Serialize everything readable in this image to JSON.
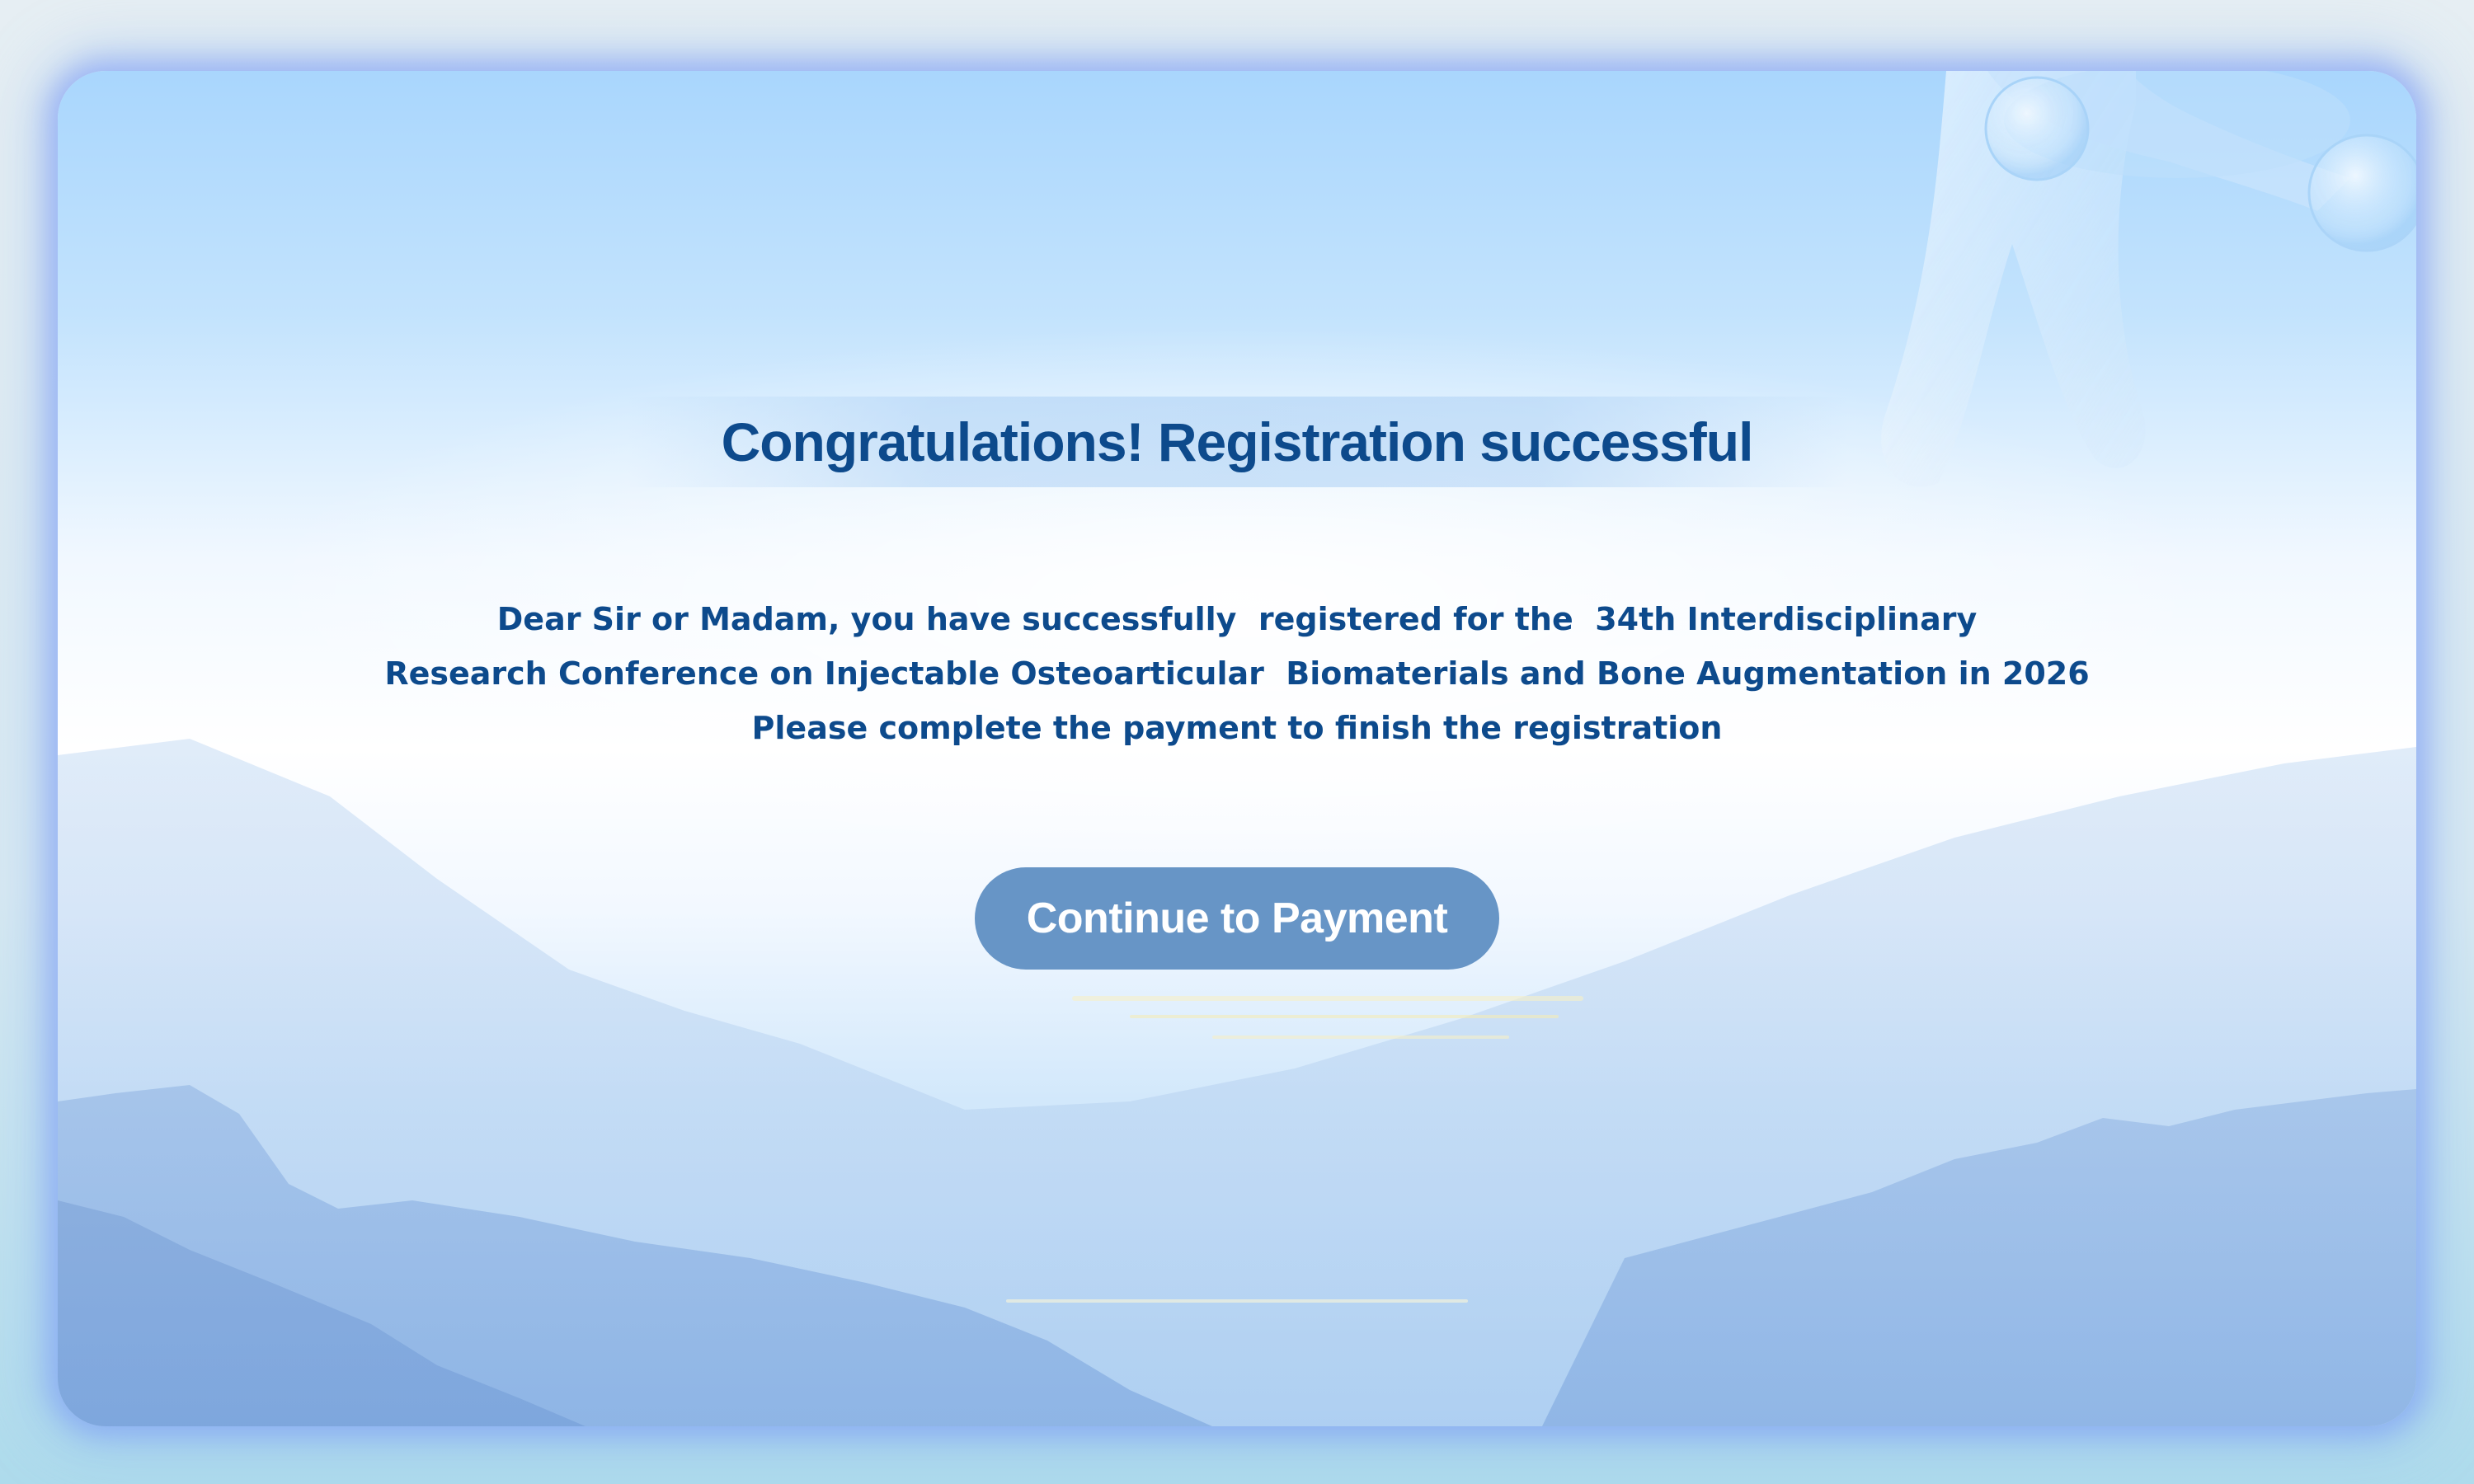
{
  "dialog": {
    "title": "Congratulations! Registration successful",
    "message_lines": [
      "Dear Sir or Madam, you have successfully  registered for the  34th Interdisciplinary",
      "Research Conference on Injectable Osteoarticular  Biomaterials and Bone Augmentation in 2026",
      "Please complete the payment to finish the registration"
    ],
    "button_label": "Continue to Payment"
  },
  "colors": {
    "text": "#0d4a8c",
    "button_background": "#6795c6",
    "button_text": "#ffffff",
    "card_glow": "#7896f5"
  }
}
